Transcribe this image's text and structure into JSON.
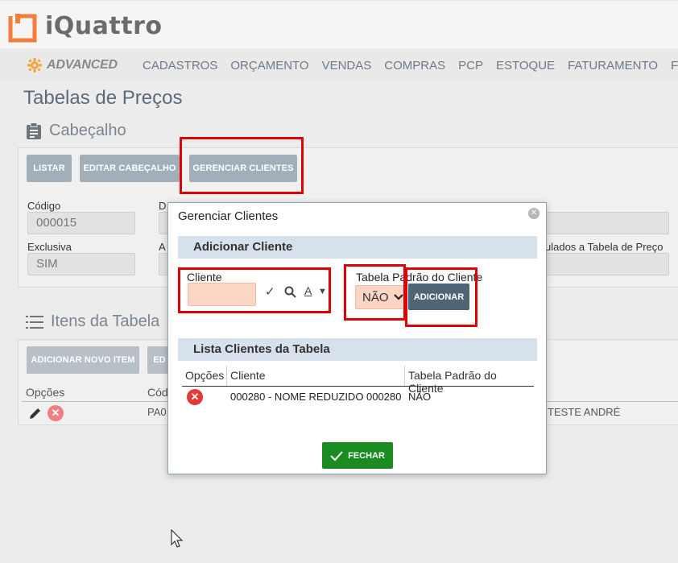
{
  "app": {
    "logo_text": "iQuattro",
    "brand_color": "#f47c3c",
    "accent_red": "#e00000"
  },
  "navbar": {
    "advanced_label": "ADVANCED",
    "items": [
      "CADASTROS",
      "ORÇAMENTO",
      "VENDAS",
      "COMPRAS",
      "PCP",
      "ESTOQUE",
      "FATURAMENTO",
      "FIN"
    ]
  },
  "page": {
    "title": "Tabelas de Preços"
  },
  "cabecalho": {
    "title": "Cabeçalho",
    "buttons": {
      "listar": "LISTAR",
      "editar": "EDITAR CABEÇALHO",
      "gerenciar": "GERENCIAR CLIENTES"
    },
    "fields": {
      "codigo_label": "Código",
      "codigo_value": "000015",
      "exclusiva_label": "Exclusiva",
      "exclusiva_value": "SIM",
      "col2_label_1": "D",
      "col2_label_2": "A",
      "vinculados_label": "ulados a Tabela de Preço"
    }
  },
  "itens": {
    "title": "Itens da Tabela",
    "add_button": "ADICIONAR NOVO ITEM",
    "ed_button": "ED",
    "col_opcoes": "Opções",
    "col_cod": "Cód",
    "row_cod": "PA0",
    "row_right": "TESTE ANDRÉ"
  },
  "modal": {
    "title": "Gerenciar Clientes",
    "adicionar": {
      "section_title": "Adicionar Cliente",
      "cliente_label": "Cliente",
      "cliente_value": "",
      "tabela_padrao_label": "Tabela Padrão do Cliente",
      "tabela_padrao_selected": "NÃO",
      "add_button": "ADICIONAR"
    },
    "lista": {
      "section_title": "Lista Clientes da Tabela",
      "headers": [
        "Opções",
        "Cliente",
        "Tabela Padrão do Cliente"
      ],
      "rows": [
        {
          "cliente": "000280 - NOME REDUZIDO 000280",
          "tabela_padrao": "NÃO"
        }
      ]
    },
    "close_button": "FECHAR"
  }
}
